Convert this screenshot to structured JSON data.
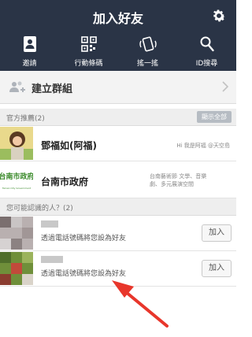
{
  "header": {
    "title": "加入好友"
  },
  "toolbar": {
    "invite": "邀請",
    "qr": "行動條碼",
    "shake": "搖一搖",
    "id_search": "ID搜尋"
  },
  "group": {
    "label": "建立群組"
  },
  "official": {
    "heading": "官方推薦(2)",
    "show_all": "顯示全部",
    "items": [
      {
        "name": "鄧福如(阿福)",
        "status": "Hi 我是阿福 @天空島"
      },
      {
        "name": "台南市政府",
        "status_line1": "台南藝術節 文學、音樂",
        "status_line2": "劇、多元展演空間",
        "logo_text": "台南市政府",
        "logo_sub": "Tainan City Government"
      }
    ]
  },
  "suggest": {
    "heading": "您可能認識的人？(2)",
    "items": [
      {
        "sub": "透過電話號碼將您設為好友",
        "add": "加入"
      },
      {
        "sub": "透過電話號碼將您設為好友",
        "add": "加入"
      }
    ]
  },
  "colors": {
    "header_bg": "#2a3446",
    "arrow": "#e8362b"
  },
  "icons": [
    "gear-icon",
    "invite-icon",
    "qr-code-icon",
    "shake-icon",
    "search-icon",
    "group-add-icon",
    "chevron-right-icon",
    "red-arrow"
  ]
}
